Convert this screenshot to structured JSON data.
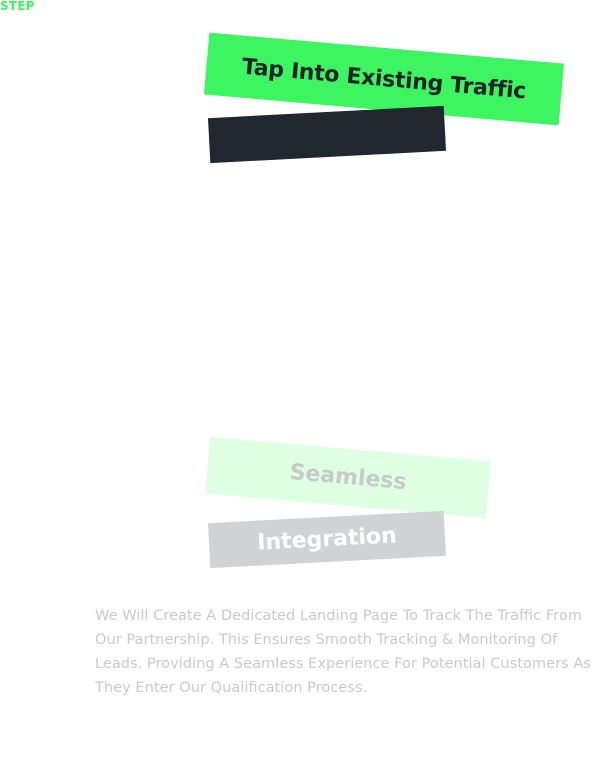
{
  "step": {
    "label": "STEP"
  },
  "feature_top": {
    "title": "Tap Into Existing Traffic",
    "subtitle": ""
  },
  "feature_bottom": {
    "title_line1": "Seamless",
    "title_line2": "Integration",
    "description": "We Will Create A Dedicated Landing Page To Track The Traffic From Our Partnership. This Ensures Smooth Tracking & Monitoring Of Leads. Providing A Seamless Experience For Potential Customers As They Enter Our Qualification Process."
  },
  "colors": {
    "accent_green": "#3df561",
    "pale_green": "#dfffe3",
    "dark": "#21272e",
    "gray": "#d1d2d3",
    "muted_text": "#c9cacb"
  }
}
